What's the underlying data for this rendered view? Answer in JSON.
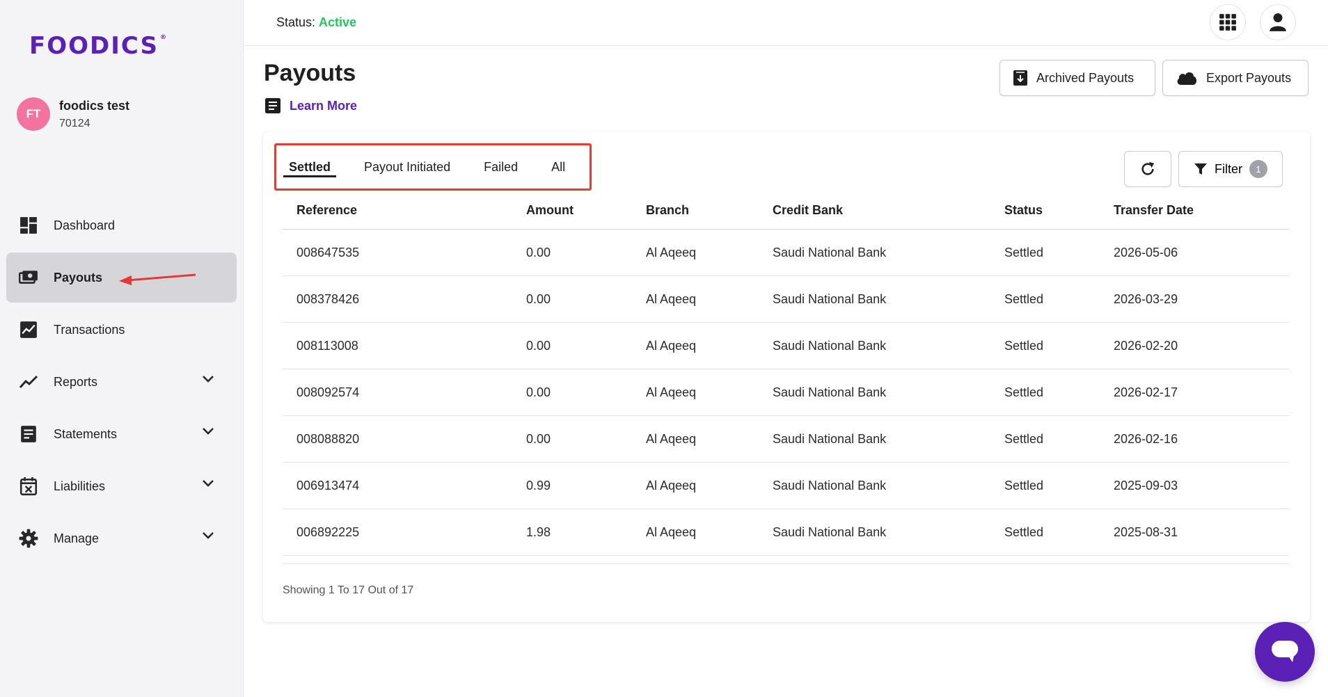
{
  "brand": {
    "logo_text": "FOODICS",
    "logo_mark": "®",
    "color": "#5b21b6"
  },
  "user": {
    "initials": "FT",
    "name": "foodics test",
    "id": "70124"
  },
  "sidebar": {
    "items": [
      {
        "label": "Dashboard",
        "icon": "dashboard-icon",
        "active": false,
        "expandable": false
      },
      {
        "label": "Payouts",
        "icon": "payouts-icon",
        "active": true,
        "expandable": false
      },
      {
        "label": "Transactions",
        "icon": "transactions-icon",
        "active": false,
        "expandable": false
      },
      {
        "label": "Reports",
        "icon": "reports-icon",
        "active": false,
        "expandable": true
      },
      {
        "label": "Statements",
        "icon": "statements-icon",
        "active": false,
        "expandable": true
      },
      {
        "label": "Liabilities",
        "icon": "liabilities-icon",
        "active": false,
        "expandable": true
      },
      {
        "label": "Manage",
        "icon": "gear-icon",
        "active": false,
        "expandable": true
      }
    ]
  },
  "topbar": {
    "status_label": "Status:",
    "status_value": "Active",
    "status_color": "#22c55e"
  },
  "page": {
    "title": "Payouts",
    "learn_more": "Learn More",
    "archived_button": "Archived Payouts",
    "export_button": "Export Payouts"
  },
  "tabs": [
    {
      "label": "Settled",
      "active": true
    },
    {
      "label": "Payout Initiated",
      "active": false
    },
    {
      "label": "Failed",
      "active": false
    },
    {
      "label": "All",
      "active": false
    }
  ],
  "filter": {
    "label": "Filter",
    "count": "1"
  },
  "table": {
    "headers": [
      "Reference",
      "Amount",
      "Branch",
      "Credit Bank",
      "Status",
      "Transfer Date"
    ],
    "rows": [
      [
        "008647535",
        "0.00",
        "Al Aqeeq",
        "Saudi National Bank",
        "Settled",
        "2026-05-06"
      ],
      [
        "008378426",
        "0.00",
        "Al Aqeeq",
        "Saudi National Bank",
        "Settled",
        "2026-03-29"
      ],
      [
        "008113008",
        "0.00",
        "Al Aqeeq",
        "Saudi National Bank",
        "Settled",
        "2026-02-20"
      ],
      [
        "008092574",
        "0.00",
        "Al Aqeeq",
        "Saudi National Bank",
        "Settled",
        "2026-02-17"
      ],
      [
        "008088820",
        "0.00",
        "Al Aqeeq",
        "Saudi National Bank",
        "Settled",
        "2026-02-16"
      ],
      [
        "006913474",
        "0.99",
        "Al Aqeeq",
        "Saudi National Bank",
        "Settled",
        "2025-09-03"
      ],
      [
        "006892225",
        "1.98",
        "Al Aqeeq",
        "Saudi National Bank",
        "Settled",
        "2025-08-31"
      ]
    ]
  },
  "pagination": {
    "text": "Showing 1 To 17 Out of 17"
  }
}
